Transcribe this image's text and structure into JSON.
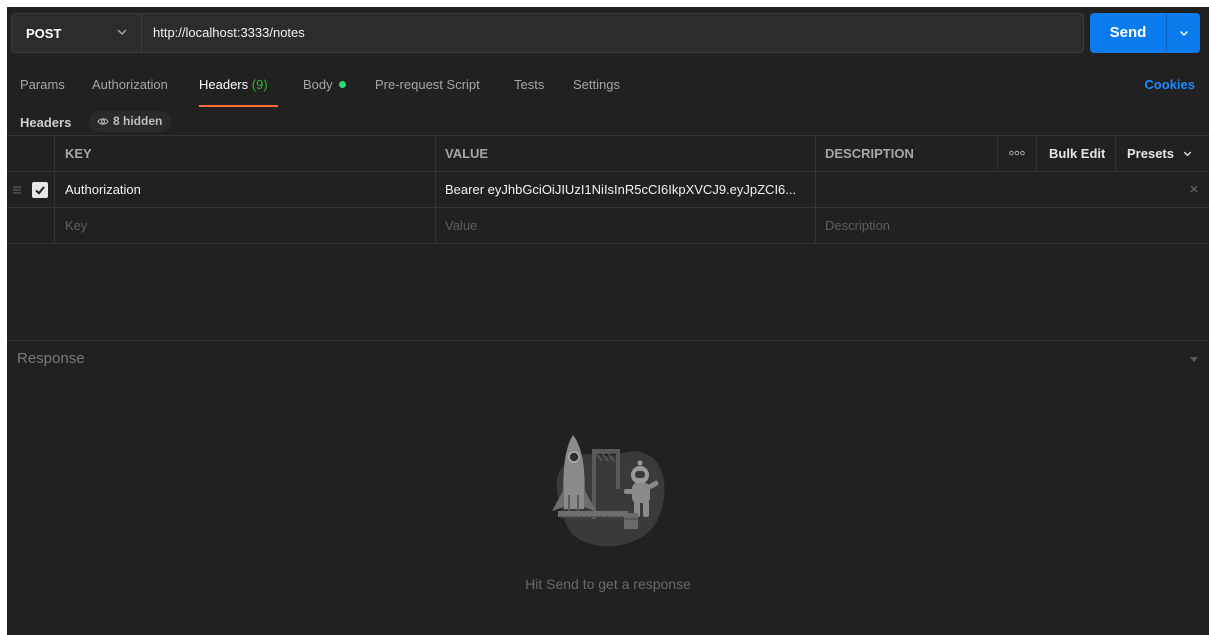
{
  "request": {
    "method": "POST",
    "url": "http://localhost:3333/notes",
    "send_label": "Send"
  },
  "tabs": [
    {
      "label": "Params"
    },
    {
      "label": "Authorization"
    },
    {
      "label": "Headers",
      "count": "(9)",
      "active": true
    },
    {
      "label": "Body"
    },
    {
      "label": "Pre-request Script"
    },
    {
      "label": "Tests"
    },
    {
      "label": "Settings"
    }
  ],
  "cookies_label": "Cookies",
  "headers_section": {
    "label": "Headers",
    "hidden_label": "8 hidden"
  },
  "table": {
    "columns": {
      "key": "KEY",
      "value": "VALUE",
      "description": "DESCRIPTION",
      "bulk_edit": "Bulk Edit",
      "presets": "Presets"
    },
    "rows": [
      {
        "checked": true,
        "key": "Authorization",
        "value": "Bearer eyJhbGciOiJIUzI1NiIsInR5cCI6IkpXVCJ9.eyJpZCI6...",
        "description": ""
      }
    ],
    "placeholder": {
      "key": "Key",
      "value": "Value",
      "description": "Description"
    }
  },
  "response": {
    "label": "Response",
    "hint": "Hit Send to get a response"
  },
  "colors": {
    "background": "#212121",
    "accent": "#097bed",
    "tab_underline": "#ff6c37",
    "count_green": "#2eb82e",
    "link_blue": "#1a8cff"
  }
}
